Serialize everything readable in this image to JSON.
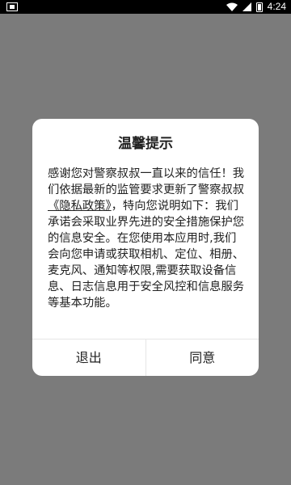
{
  "status_bar": {
    "time": "4:24",
    "icons": [
      "notification-icon",
      "wifi-icon",
      "signal-icon",
      "battery-icon"
    ]
  },
  "dialog": {
    "title": "温馨提示",
    "body_before_link": "感谢您对警察叔叔一直以来的信任！我们依据最新的监管要求更新了警察叔叔",
    "policy_link": "《隐私政策》",
    "body_after_link": "，特向您说明如下：我们承诺会采取业界先进的安全措施保护您的信息安全。在您使用本应用时,我们会向您申请或获取相机、定位、相册、麦克风、通知等权限,需要获取设备信息、日志信息用于安全风控和信息服务等基本功能。",
    "exit_label": "退出",
    "agree_label": "同意"
  },
  "colors": {
    "overlay": "#7b7b7b",
    "dialog_background": "#ffffff",
    "text": "#222222"
  }
}
